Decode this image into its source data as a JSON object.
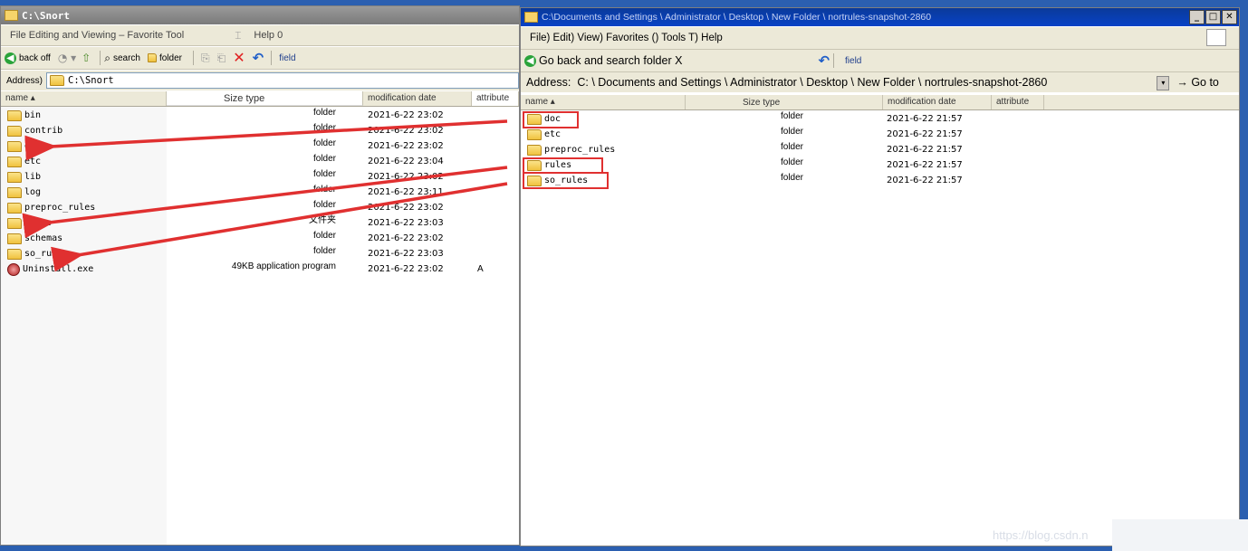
{
  "left": {
    "title": "C:\\Snort",
    "menu": [
      "File Editing and Viewing – Favorite Tool",
      "Help 0"
    ],
    "toolbar": {
      "back": "back off",
      "search": "search",
      "folder": "folder",
      "field": "field"
    },
    "address_label": "Address)",
    "address_value": "C:\\Snort",
    "columns": {
      "name": "name",
      "size_type": "Size type",
      "date": "modification date",
      "attr": "attribute"
    },
    "rows": [
      {
        "name": "bin",
        "type": "folder",
        "date": "2021-6-22 23:02",
        "attr": ""
      },
      {
        "name": "contrib",
        "type": "folder",
        "date": "2021-6-22 23:02",
        "attr": ""
      },
      {
        "name": "doc",
        "type": "folder",
        "date": "2021-6-22 23:02",
        "attr": ""
      },
      {
        "name": "etc",
        "type": "folder",
        "date": "2021-6-22 23:04",
        "attr": ""
      },
      {
        "name": "lib",
        "type": "folder",
        "date": "2021-6-22 23:02",
        "attr": ""
      },
      {
        "name": "log",
        "type": "folder",
        "date": "2021-6-22 23:11",
        "attr": ""
      },
      {
        "name": "preproc_rules",
        "type": "folder",
        "date": "2021-6-22 23:02",
        "attr": ""
      },
      {
        "name": "rules",
        "type": "文件夹",
        "date": "2021-6-22 23:03",
        "attr": ""
      },
      {
        "name": "schemas",
        "type": "folder",
        "date": "2021-6-22 23:02",
        "attr": ""
      },
      {
        "name": "so_rules",
        "type": "folder",
        "date": "2021-6-22 23:03",
        "attr": ""
      },
      {
        "name": "Uninstall.exe",
        "type": "49KB application program",
        "date": "2021-6-22 23:02",
        "attr": "A"
      }
    ]
  },
  "right": {
    "title": "C:\\Documents and Settings \\ Administrator \\ Desktop \\ New Folder \\ nortrules-snapshot-2860",
    "menu": "File) Edit) View) Favorites () Tools T) Help",
    "toolbar": {
      "back": "Go back and search folder X",
      "field": "field"
    },
    "address_label": "Address:",
    "address_value": "C: \\ Documents and Settings \\ Administrator \\ Desktop \\ New Folder \\ nortrules-snapshot-2860",
    "goto": "→ Go to",
    "columns": {
      "name": "name",
      "size_type": "Size type",
      "date": "modification date",
      "attr": "attribute"
    },
    "rows": [
      {
        "name": "doc",
        "type": "folder",
        "date": "2021-6-22 21:57"
      },
      {
        "name": "etc",
        "type": "folder",
        "date": "2021-6-22 21:57"
      },
      {
        "name": "preproc_rules",
        "type": "folder",
        "date": "2021-6-22 21:57"
      },
      {
        "name": "rules",
        "type": "folder",
        "date": "2021-6-22 21:57"
      },
      {
        "name": "so_rules",
        "type": "folder",
        "date": "2021-6-22 21:57"
      }
    ]
  },
  "watermark": "https://blog.csdn.n",
  "colors": {
    "annotation": "#e03030",
    "desktop": "#2b5fb0"
  }
}
